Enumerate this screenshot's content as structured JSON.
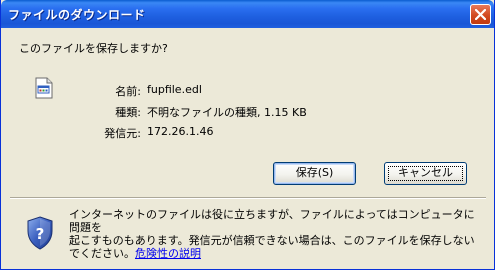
{
  "window": {
    "title": "ファイルのダウンロード"
  },
  "dialog": {
    "question": "このファイルを保存しますか?",
    "fields": [
      {
        "label": "名前:",
        "value": "fupfile.edl"
      },
      {
        "label": "種類:",
        "value": "不明なファイルの種類, 1.15 KB"
      },
      {
        "label": "発信元:",
        "value": "172.26.1.46"
      }
    ],
    "buttons": {
      "save": "保存(S)",
      "cancel": "キャンセル"
    },
    "warning": {
      "line1": "インターネットのファイルは役に立ちますが、ファイルによってはコンピュータに問題を",
      "line2": "起こすものもあります。発信元が信頼できない場合は、このファイルを保存しない",
      "line3_prefix": "でください。",
      "link": "危険性の説明"
    }
  },
  "icons": {
    "close": "close-icon",
    "file": "file-icon",
    "shield": "shield-help-icon"
  },
  "colors": {
    "titlebar": "#2a6ff0",
    "dialog_bg": "#ece9d8",
    "close_button": "#d24a20",
    "link": "#0000ee",
    "shield": "#3a5fbf"
  }
}
